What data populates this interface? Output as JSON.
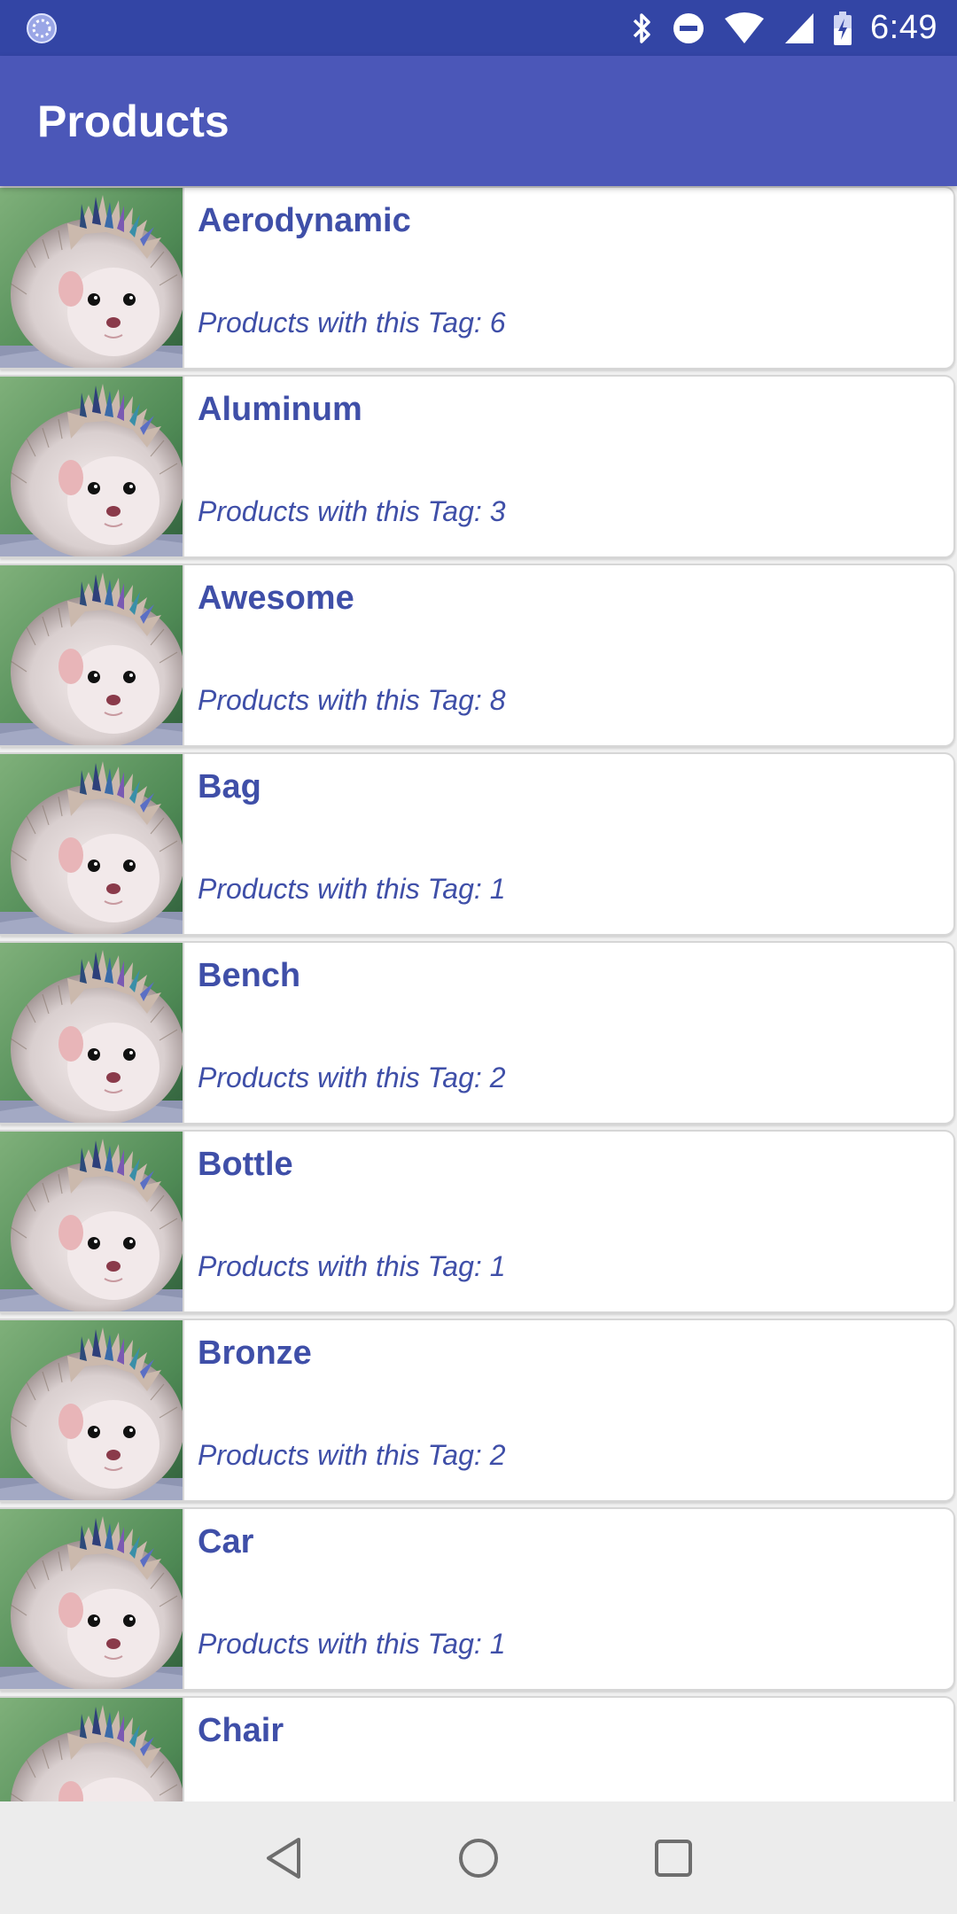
{
  "status_bar": {
    "time": "6:49",
    "icons": [
      "sync-icon",
      "bluetooth-icon",
      "do-not-disturb-icon",
      "wifi-icon",
      "cell-signal-icon",
      "battery-charging-icon"
    ]
  },
  "app_bar": {
    "title": "Products"
  },
  "list": {
    "subtitle_prefix": "Products with this Tag:",
    "items": [
      {
        "name": "Aerodynamic",
        "count": "6",
        "image": "hedgehog-image"
      },
      {
        "name": "Aluminum",
        "count": "3",
        "image": "hedgehog-image"
      },
      {
        "name": "Awesome",
        "count": "8",
        "image": "hedgehog-image"
      },
      {
        "name": "Bag",
        "count": "1",
        "image": "hedgehog-image"
      },
      {
        "name": "Bench",
        "count": "2",
        "image": "hedgehog-image"
      },
      {
        "name": "Bottle",
        "count": "1",
        "image": "hedgehog-image"
      },
      {
        "name": "Bronze",
        "count": "2",
        "image": "hedgehog-image"
      },
      {
        "name": "Car",
        "count": "1",
        "image": "hedgehog-image"
      },
      {
        "name": "Chair",
        "count": "",
        "image": "hedgehog-image"
      }
    ]
  },
  "nav_bar": {
    "icons": [
      "back-icon",
      "home-icon",
      "recents-icon"
    ]
  },
  "colors": {
    "status_bar": "#3345a5",
    "app_bar": "#4b57b8",
    "accent_text": "#3f4fa8",
    "nav_bar": "#ececec"
  }
}
